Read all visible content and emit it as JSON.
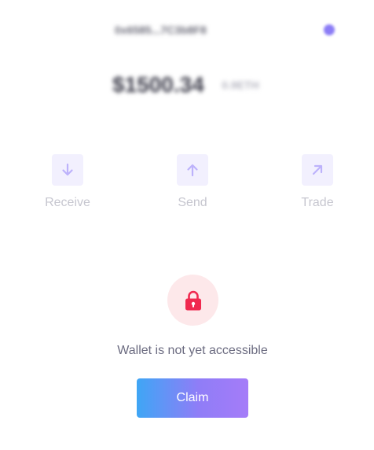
{
  "wallet": {
    "address": "0x6585...7C3b8F8",
    "status_color": "#8b7cf6"
  },
  "balance": {
    "usd": "$1500.34",
    "eth": "0.9ETH"
  },
  "actions": [
    {
      "label": "Receive",
      "icon": "arrow-down-icon"
    },
    {
      "label": "Send",
      "icon": "arrow-up-icon"
    },
    {
      "label": "Trade",
      "icon": "arrow-up-right-icon"
    }
  ],
  "lock": {
    "icon": "lock-icon",
    "message": "Wallet is not yet accessible",
    "icon_color": "#f0294f"
  },
  "claim": {
    "label": "Claim"
  },
  "colors": {
    "accent": "#8f7df7",
    "gradient_start": "#3ea6f5",
    "gradient_end": "#a57cf8"
  }
}
